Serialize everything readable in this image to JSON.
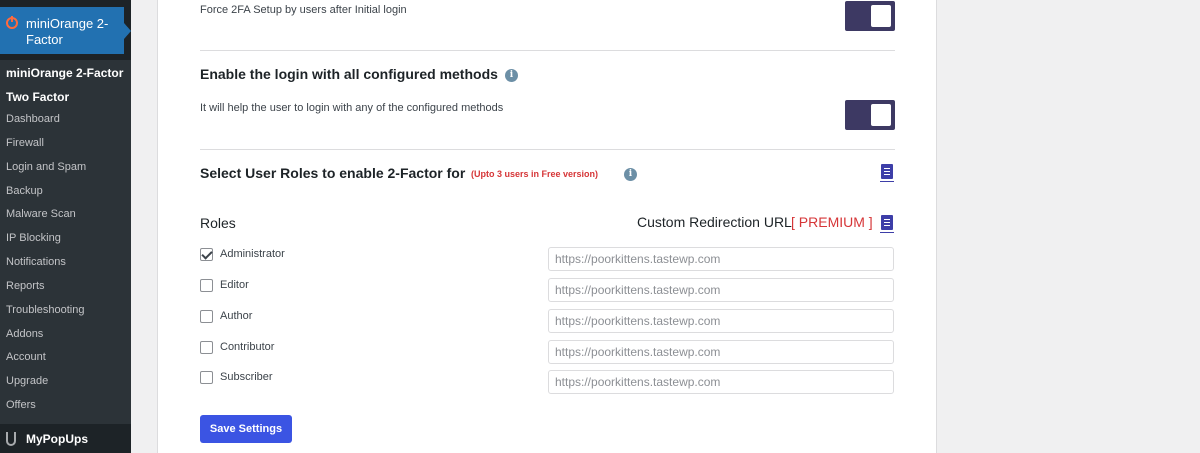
{
  "sidebar": {
    "active_menu": {
      "label": "miniOrange 2-Factor",
      "icon": "miniorange-power-icon"
    },
    "submenu": [
      {
        "label": "miniOrange 2-Factor",
        "bold": true
      },
      {
        "label": "Two Factor",
        "bold": true
      },
      {
        "label": "Dashboard"
      },
      {
        "label": "Firewall"
      },
      {
        "label": "Login and Spam"
      },
      {
        "label": "Backup"
      },
      {
        "label": "Malware Scan"
      },
      {
        "label": "IP Blocking"
      },
      {
        "label": "Notifications"
      },
      {
        "label": "Reports"
      },
      {
        "label": "Troubleshooting"
      },
      {
        "label": "Addons"
      },
      {
        "label": "Account"
      },
      {
        "label": "Upgrade"
      },
      {
        "label": "Offers"
      }
    ],
    "bottom_menu": {
      "label": "MyPopUps",
      "icon": "mypopups-icon"
    }
  },
  "settings": {
    "force_2fa": {
      "description": "Force 2FA Setup by users after Initial login",
      "enabled": true
    },
    "login_all_methods": {
      "title": "Enable the login with all configured methods",
      "description": "It will help the user to login with any of the configured methods",
      "enabled": true
    },
    "user_roles": {
      "title": "Select User Roles to enable 2-Factor for",
      "note": "(Upto 3 users in Free version)",
      "roles_header": "Roles",
      "redirect_header": "Custom Redirection URL",
      "premium_label": "[ PREMIUM ]",
      "roles": [
        {
          "name": "Administrator",
          "checked": true,
          "url": "https://poorkittens.tastewp.com"
        },
        {
          "name": "Editor",
          "checked": false,
          "url": "https://poorkittens.tastewp.com"
        },
        {
          "name": "Author",
          "checked": false,
          "url": "https://poorkittens.tastewp.com"
        },
        {
          "name": "Contributor",
          "checked": false,
          "url": "https://poorkittens.tastewp.com"
        },
        {
          "name": "Subscriber",
          "checked": false,
          "url": "https://poorkittens.tastewp.com"
        }
      ]
    },
    "save_button": "Save Settings"
  },
  "colors": {
    "sidebar_bg": "#1d2327",
    "sidebar_active": "#2271b1",
    "toggle_on": "#3d3963",
    "premium_red": "#d63638",
    "save_button": "#3b54e3"
  }
}
